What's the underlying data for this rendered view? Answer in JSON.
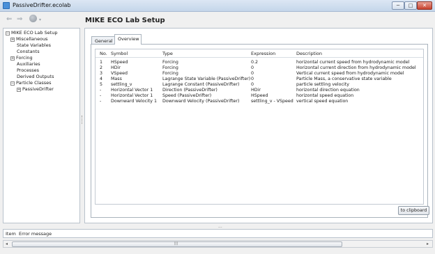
{
  "window": {
    "title": "PassiveDrifter.ecolab",
    "min": "─",
    "max": "□",
    "close": "✕"
  },
  "nav": {
    "back": "⇐",
    "forward": "⇒",
    "dropdown": "▾"
  },
  "tree": [
    {
      "label": "MIKE ECO Lab Setup",
      "toggle": "−"
    },
    {
      "label": "Miscellaneous",
      "toggle": "+"
    },
    {
      "label": "State Variables",
      "toggle": ""
    },
    {
      "label": "Constants",
      "toggle": ""
    },
    {
      "label": "Forcing",
      "toggle": "+"
    },
    {
      "label": "Auxiliaries",
      "toggle": ""
    },
    {
      "label": "Processes",
      "toggle": ""
    },
    {
      "label": "Derived Outputs",
      "toggle": ""
    },
    {
      "label": "Particle Classes",
      "toggle": "−"
    },
    {
      "label": "PassiveDrifter",
      "toggle": "+"
    }
  ],
  "main": {
    "heading": "MIKE ECO Lab Setup",
    "tabs": [
      "General",
      "Overview"
    ],
    "table": {
      "columns": [
        "No.",
        "Symbol",
        "Type",
        "Expression",
        "Description"
      ],
      "rows": [
        [
          "1",
          "HSpeed",
          "Forcing",
          "0.2",
          "horizontal current speed from hydrodynamic model"
        ],
        [
          "2",
          "HDir",
          "Forcing",
          "0",
          "Horizontal current direction from hydrodynamic model"
        ],
        [
          "3",
          "VSpeed",
          "Forcing",
          "0",
          "Vertical current speed from hydrodynamic model"
        ],
        [
          "4",
          "Mass",
          "Lagrange State Variable (PassiveDrifter)",
          "0",
          "Particle Mass, a conservative state variable"
        ],
        [
          "5",
          "settling_v",
          "Lagrange Constant (PassiveDrifter)",
          "0",
          "particle settling velocity"
        ],
        [
          "-",
          "Horizontal Vector 1",
          "Direction (PassiveDrifter)",
          "HDir",
          "horizontal direction equation"
        ],
        [
          "-",
          "Horizontal Vector 1",
          "Speed (PassiveDrifter)",
          "HSpeed",
          "horizontal speed equation"
        ],
        [
          "-",
          "Downward Velocity 1",
          "Downward Velocity (PassiveDrifter)",
          "settling_v - VSpeed",
          "vertical speed equation"
        ]
      ]
    },
    "clipboard_button": "to clipboard"
  },
  "splitter_dots": "...",
  "error_panel": {
    "col_item": "Item",
    "col_message": "Error message"
  },
  "scrollbar": {
    "left": "◂",
    "right": "▸",
    "grip": "|||"
  }
}
